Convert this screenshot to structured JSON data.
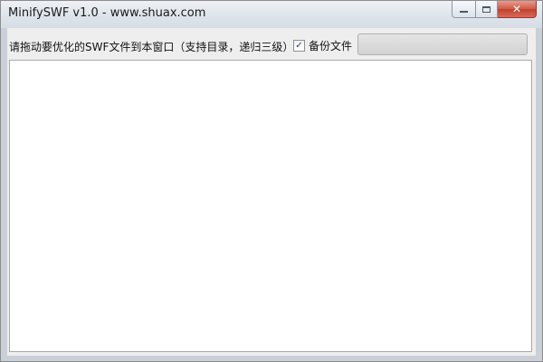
{
  "window": {
    "title": "MinifySWF v1.0 - www.shuax.com",
    "buttons": {
      "minimize_icon": "minimize-icon",
      "maximize_icon": "maximize-icon",
      "close_icon": "close-icon",
      "close_glyph": "✕"
    },
    "colors": {
      "close_button": "#c1412c",
      "title_bar": "#dde3ea"
    }
  },
  "main": {
    "instruction": "请拖动要优化的SWF文件到本窗口（支持目录，递归三级）",
    "backup_checkbox": {
      "label": "备份文件",
      "checked": true,
      "check_glyph": "✓"
    },
    "progress": {
      "value": 0
    },
    "drop_area": {
      "items": []
    }
  }
}
